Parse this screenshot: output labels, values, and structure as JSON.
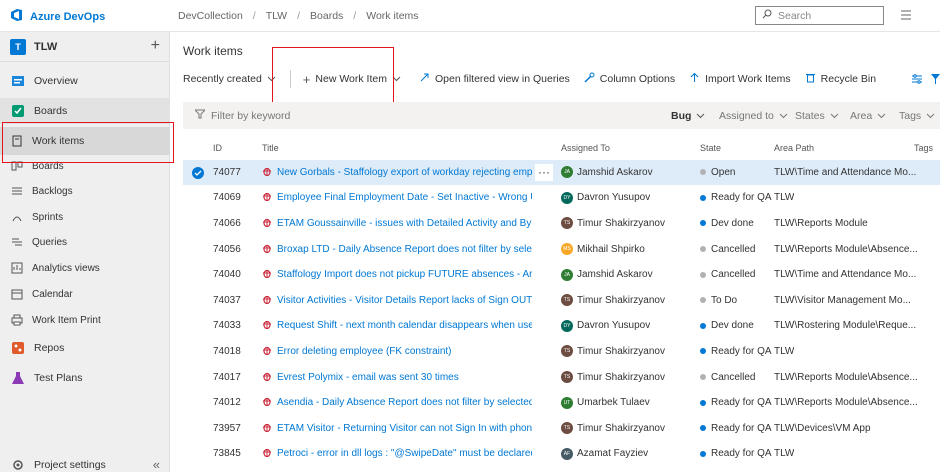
{
  "brand": {
    "name": "Azure DevOps"
  },
  "breadcrumb": [
    "DevCollection",
    "TLW",
    "Boards",
    "Work items"
  ],
  "search": {
    "placeholder": "Search"
  },
  "project": {
    "badge": "T",
    "name": "TLW"
  },
  "nav": {
    "overview": "Overview",
    "boards": "Boards",
    "work_items": "Work items",
    "boards_sub": "Boards",
    "backlogs": "Backlogs",
    "sprints": "Sprints",
    "queries": "Queries",
    "analytics": "Analytics views",
    "calendar": "Calendar",
    "work_item_print": "Work Item Print",
    "repos": "Repos",
    "test_plans": "Test Plans",
    "project_settings": "Project settings"
  },
  "page": {
    "title": "Work items"
  },
  "toolbar": {
    "recently_created": "Recently created",
    "new_work_item": "New Work Item",
    "open_in_queries": "Open filtered view in Queries",
    "column_options": "Column Options",
    "import": "Import Work Items",
    "recycle_bin": "Recycle Bin"
  },
  "filter": {
    "keyword_placeholder": "Filter by keyword",
    "type": "Bug",
    "assigned_to": "Assigned to",
    "states": "States",
    "area": "Area",
    "tags": "Tags"
  },
  "columns": {
    "id": "ID",
    "title": "Title",
    "assigned": "Assigned To",
    "state": "State",
    "area": "Area Path",
    "tags": "Tags"
  },
  "colors": {
    "accent": "#0078d4",
    "bug": "#cc293d",
    "highlight": "#e0161d"
  },
  "rows": [
    {
      "id": "74077",
      "title": "New Gorbals - Staffology export of workday rejecting employ...",
      "assigned": "Jamshid Askarov",
      "initials": "JA",
      "avatar_color": "#2e7d32",
      "state": "Open",
      "state_color": "#b2b2b2",
      "area": "TLW\\Time and Attendance Mo...",
      "selected": true
    },
    {
      "id": "74069",
      "title": "Employee Final Employment Date - Set Inactive - Wrong User in au...",
      "assigned": "Davron Yusupov",
      "initials": "DY",
      "avatar_color": "#00695c",
      "state": "Ready for QA",
      "state_color": "#0078d4",
      "area": "TLW"
    },
    {
      "id": "74066",
      "title": "ETAM Goussainville - issues with Detailed Activity and By Employe...",
      "assigned": "Timur Shakirzyanov",
      "initials": "TS",
      "avatar_color": "#6d4c41",
      "state": "Dev done",
      "state_color": "#0078d4",
      "area": "TLW\\Reports Module"
    },
    {
      "id": "74056",
      "title": "Broxap LTD - Daily Absence Report does not filter by selected abse...",
      "assigned": "Mikhail Shpirko",
      "initials": "MS",
      "avatar_color": "#f9a825",
      "state": "Cancelled",
      "state_color": "#b2b2b2",
      "area": "TLW\\Reports Module\\Absence..."
    },
    {
      "id": "74040",
      "title": "Staffology Import does not pickup FUTURE absences - Aralon, Ferr...",
      "assigned": "Jamshid Askarov",
      "initials": "JA",
      "avatar_color": "#2e7d32",
      "state": "Cancelled",
      "state_color": "#b2b2b2",
      "area": "TLW\\Time and Attendance Mo..."
    },
    {
      "id": "74037",
      "title": "Visitor Activities - Visitor Details Report lacks of Sign OUT info and ...",
      "assigned": "Timur Shakirzyanov",
      "initials": "TS",
      "avatar_color": "#6d4c41",
      "state": "To Do",
      "state_color": "#b2b2b2",
      "area": "TLW\\Visitor Management Mo..."
    },
    {
      "id": "74033",
      "title": "Request Shift - next month calendar disappears when user switche...",
      "assigned": "Davron Yusupov",
      "initials": "DY",
      "avatar_color": "#00695c",
      "state": "Dev done",
      "state_color": "#0078d4",
      "area": "TLW\\Rostering Module\\Reque..."
    },
    {
      "id": "74018",
      "title": "Error deleting employee (FK constraint)",
      "assigned": "Timur Shakirzyanov",
      "initials": "TS",
      "avatar_color": "#6d4c41",
      "state": "Ready for QA",
      "state_color": "#0078d4",
      "area": "TLW"
    },
    {
      "id": "74017",
      "title": "Evrest Polymix - email was sent 30 times",
      "assigned": "Timur Shakirzyanov",
      "initials": "TS",
      "avatar_color": "#6d4c41",
      "state": "Cancelled",
      "state_color": "#b2b2b2",
      "area": "TLW\\Reports Module\\Absence..."
    },
    {
      "id": "74012",
      "title": "Asendia - Daily Absence Report does not filter by selected absence...",
      "assigned": "Umarbek Tulaev",
      "initials": "UT",
      "avatar_color": "#2e7d32",
      "state": "Ready for QA",
      "state_color": "#0078d4",
      "area": "TLW\\Reports Module\\Absence..."
    },
    {
      "id": "73957",
      "title": "ETAM Visitor - Returning Visitor can not Sign In with phone number",
      "assigned": "Timur Shakirzyanov",
      "initials": "TS",
      "avatar_color": "#6d4c41",
      "state": "Ready for QA",
      "state_color": "#0078d4",
      "area": "TLW\\Devices\\VM App"
    },
    {
      "id": "73845",
      "title": "Petroci - error in dll logs : \"@SwipeDate\" must be declared",
      "assigned": "Azamat Fayziev",
      "initials": "AF",
      "avatar_color": "#455a64",
      "state": "Ready for QA",
      "state_color": "#0078d4",
      "area": "TLW"
    }
  ]
}
